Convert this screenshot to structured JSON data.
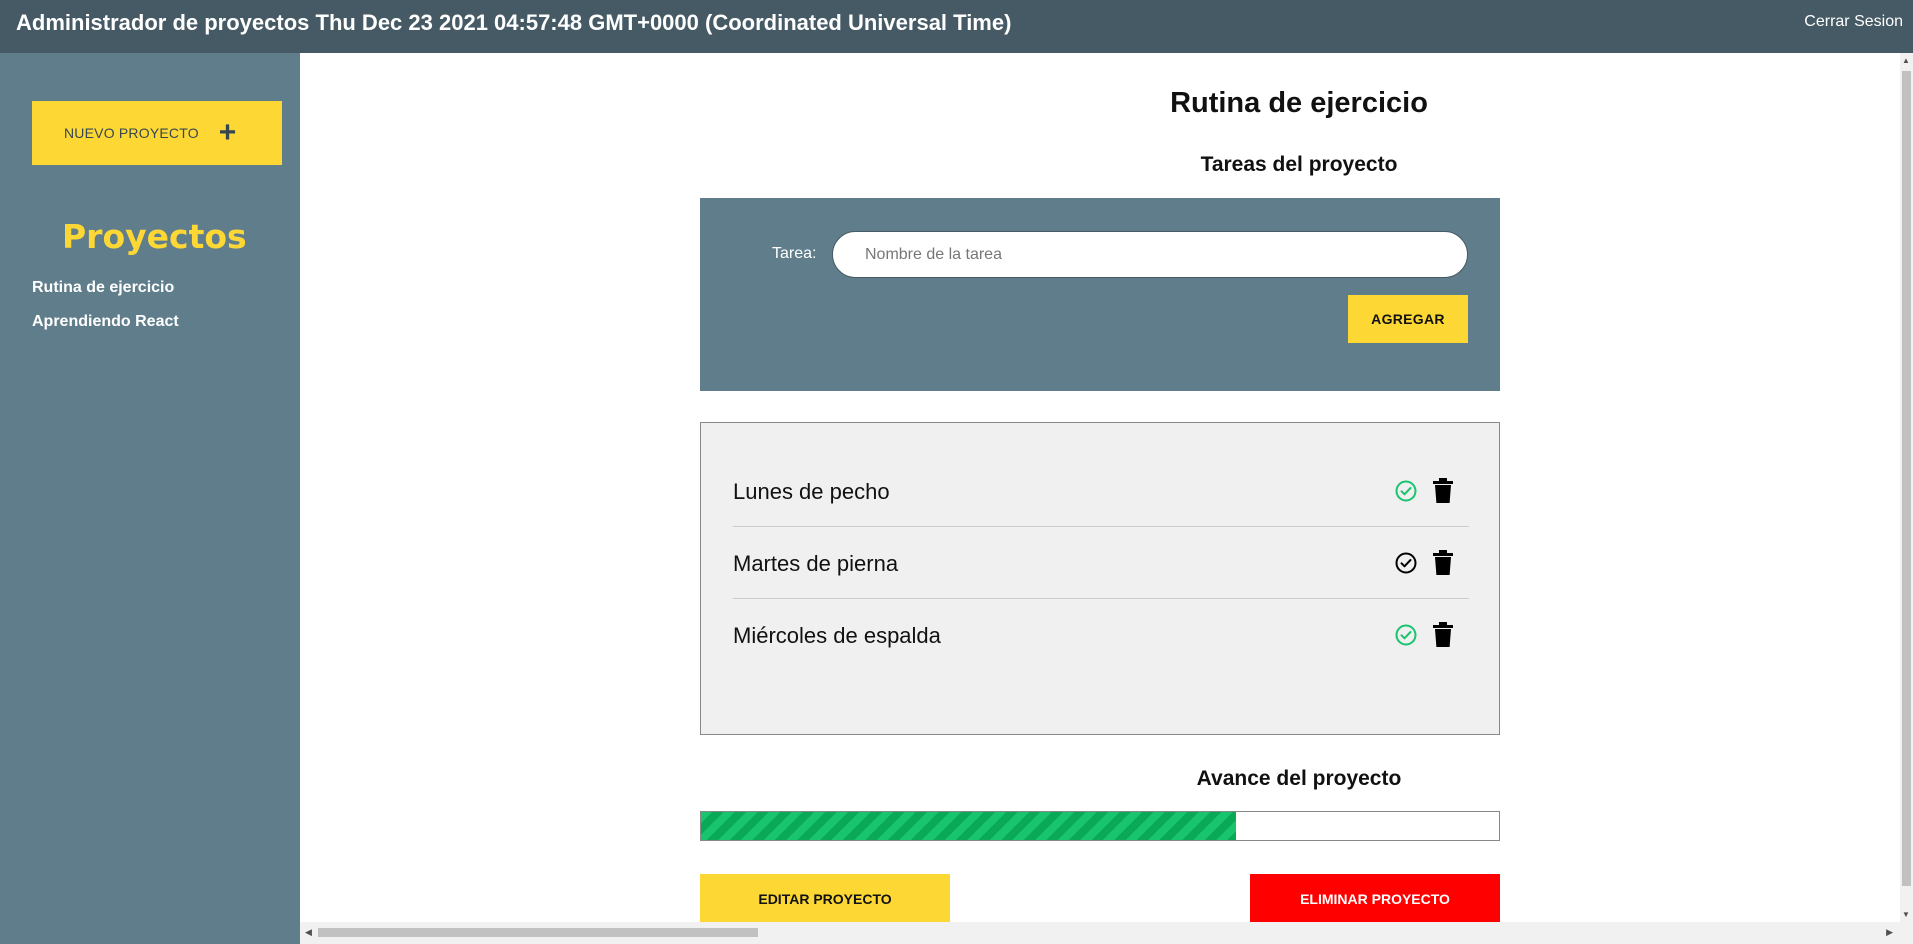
{
  "header": {
    "title": "Administrador de proyectos Thu Dec 23 2021 04:57:48 GMT+0000 (Coordinated Universal Time)",
    "logout_label": "Cerrar Sesion"
  },
  "sidebar": {
    "new_project_label": "NUEVO PROYECTO",
    "new_project_icon": "+",
    "heading": "Proyectos",
    "projects": [
      {
        "label": "Rutina de ejercicio"
      },
      {
        "label": "Aprendiendo React"
      }
    ]
  },
  "main": {
    "project_title": "Rutina de ejercicio",
    "tasks_heading": "Tareas del proyecto",
    "form": {
      "label": "Tarea:",
      "placeholder": "Nombre de la tarea",
      "value": "",
      "add_label": "AGREGAR"
    },
    "tasks": [
      {
        "name": "Lunes de pecho",
        "complete": true,
        "check_icon": "check-circle-icon",
        "delete_icon": "trash-icon"
      },
      {
        "name": "Martes de pierna",
        "complete": false,
        "check_icon": "check-circle-icon",
        "delete_icon": "trash-icon"
      },
      {
        "name": "Miércoles de espalda",
        "complete": true,
        "check_icon": "check-circle-icon",
        "delete_icon": "trash-icon"
      }
    ],
    "progress_heading": "Avance del proyecto",
    "progress_fraction": 0.67,
    "edit_label": "EDITAR PROYECTO",
    "delete_label": "ELIMINAR PROYECTO"
  },
  "colors": {
    "header_bg": "#455a64",
    "sidebar_bg": "#607d8b",
    "accent_yellow": "#fdd835",
    "complete_green": "#19c46e",
    "incomplete_black": "#000000",
    "danger_red": "#ff0000"
  }
}
